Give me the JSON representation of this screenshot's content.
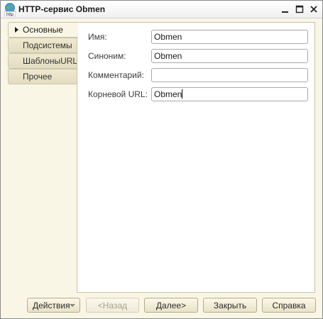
{
  "window": {
    "title": "HTTP-сервис Obmen",
    "icon": "http-globe-icon",
    "controls": {
      "minimize": "_",
      "maximize": "□",
      "close": "✕"
    }
  },
  "tabs": [
    {
      "label": "Основные",
      "active": true
    },
    {
      "label": "Подсистемы",
      "active": false
    },
    {
      "label": "ШаблоныURL",
      "active": false
    },
    {
      "label": "Прочее",
      "active": false
    }
  ],
  "form": {
    "name": {
      "label": "Имя:",
      "value": "Obmen"
    },
    "synonym": {
      "label": "Синоним:",
      "value": "Obmen"
    },
    "comment": {
      "label": "Комментарий:",
      "value": ""
    },
    "root_url": {
      "label": "Корневой URL:",
      "value": "Obmen"
    }
  },
  "buttons": {
    "actions": "Действия",
    "back": "<Назад",
    "next": "Далее>",
    "close": "Закрыть",
    "help": "Справка"
  },
  "colors": {
    "panel_background": "#faf6e6",
    "tab_background": "#e3dcc0",
    "border": "#c9c2a6"
  }
}
